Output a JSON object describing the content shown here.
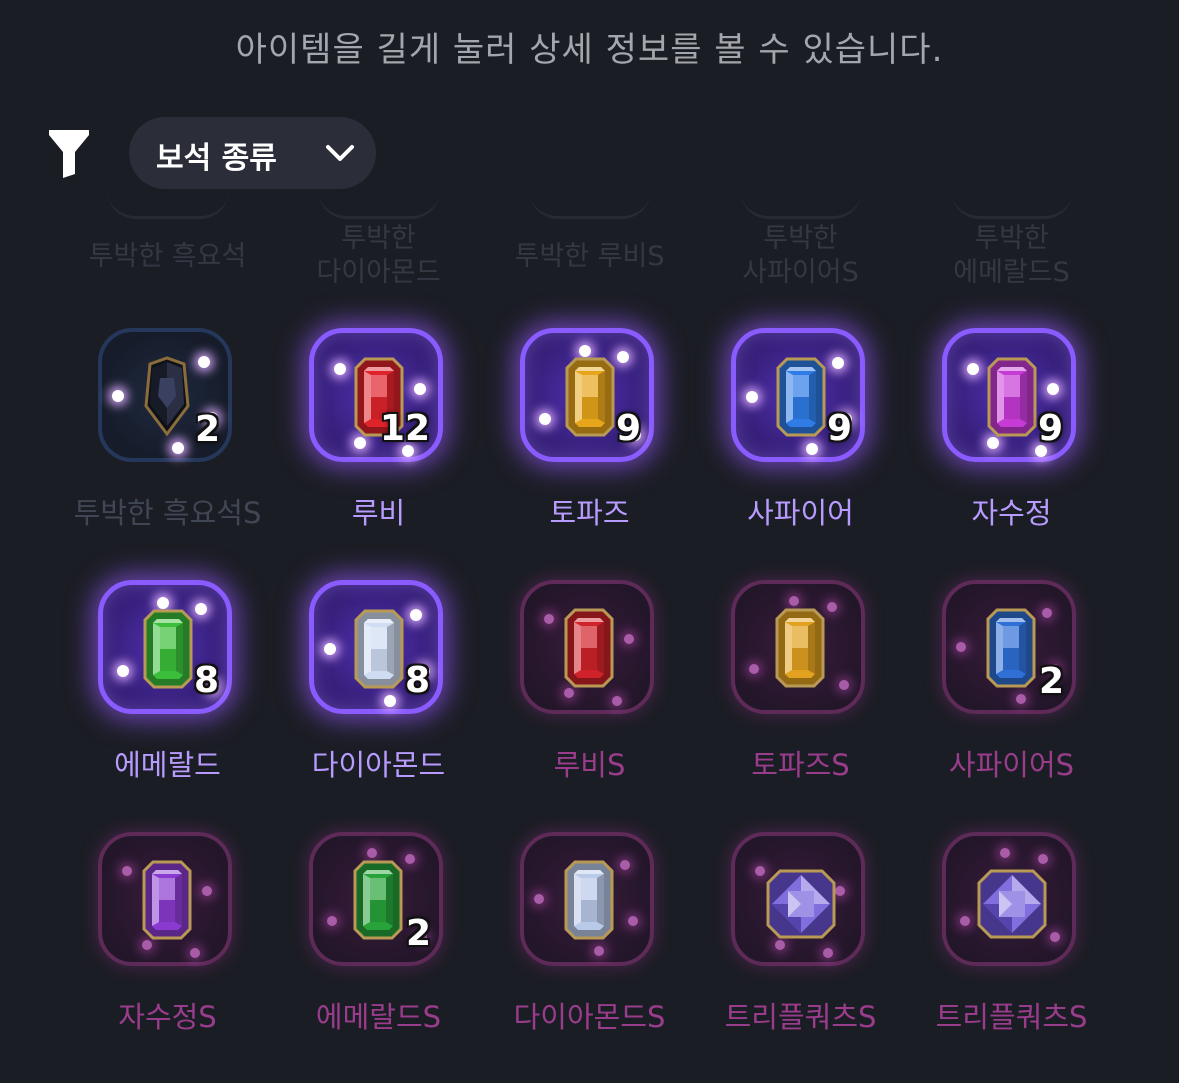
{
  "header": {
    "hint": "아이템을 길게 눌러 상세 정보를 볼 수 있습니다."
  },
  "filter": {
    "icon": "filter-icon",
    "dropdown_label": "보석 종류",
    "dropdown_icon": "chevron-down-icon"
  },
  "faded_row": [
    {
      "name": "투박한 흑요석"
    },
    {
      "name": "투박한\n다이아몬드"
    },
    {
      "name": "투박한 루비S"
    },
    {
      "name": "투박한\n사파이어S"
    },
    {
      "name": "투박한\n에메랄드S"
    }
  ],
  "grid": [
    [
      {
        "name": "투박한 흑요석S",
        "count": "2",
        "frame": "blue",
        "gem": "obsidian",
        "color": "#1c1f2e"
      },
      {
        "name": "루비",
        "count": "12",
        "frame": "purple",
        "gem": "rect",
        "color": "#e0232b"
      },
      {
        "name": "토파즈",
        "count": "9",
        "frame": "purple",
        "gem": "rect",
        "color": "#e6a51a"
      },
      {
        "name": "사파이어",
        "count": "9",
        "frame": "purple",
        "gem": "rect",
        "color": "#2f7ce6"
      },
      {
        "name": "자수정",
        "count": "9",
        "frame": "purple",
        "gem": "rect",
        "color": "#c63ad6"
      }
    ],
    [
      {
        "name": "에메랄드",
        "count": "8",
        "frame": "purple",
        "gem": "rect",
        "color": "#3bbf3a"
      },
      {
        "name": "다이아몬드",
        "count": "8",
        "frame": "purple",
        "gem": "rect",
        "color": "#cfdcf2"
      },
      {
        "name": "루비S",
        "count": "",
        "frame": "pink",
        "gem": "rect",
        "color": "#d0222a"
      },
      {
        "name": "토파즈S",
        "count": "",
        "frame": "pink",
        "gem": "rect",
        "color": "#e2a11f"
      },
      {
        "name": "사파이어S",
        "count": "2",
        "frame": "pink",
        "gem": "rect",
        "color": "#2f6fd6"
      }
    ],
    [
      {
        "name": "자수정S",
        "count": "",
        "frame": "pink",
        "gem": "rect",
        "color": "#8a3ad0"
      },
      {
        "name": "에메랄드S",
        "count": "2",
        "frame": "pink",
        "gem": "rect",
        "color": "#27a33a"
      },
      {
        "name": "다이아몬드S",
        "count": "",
        "frame": "pink",
        "gem": "rect",
        "color": "#b9c9e8"
      },
      {
        "name": "트리플쿼츠S",
        "count": "",
        "frame": "pink",
        "gem": "square",
        "color": "#6c55d8"
      },
      {
        "name": "트리플쿼츠S",
        "count": "",
        "frame": "pink",
        "gem": "square",
        "color": "#6c55d8"
      }
    ]
  ]
}
